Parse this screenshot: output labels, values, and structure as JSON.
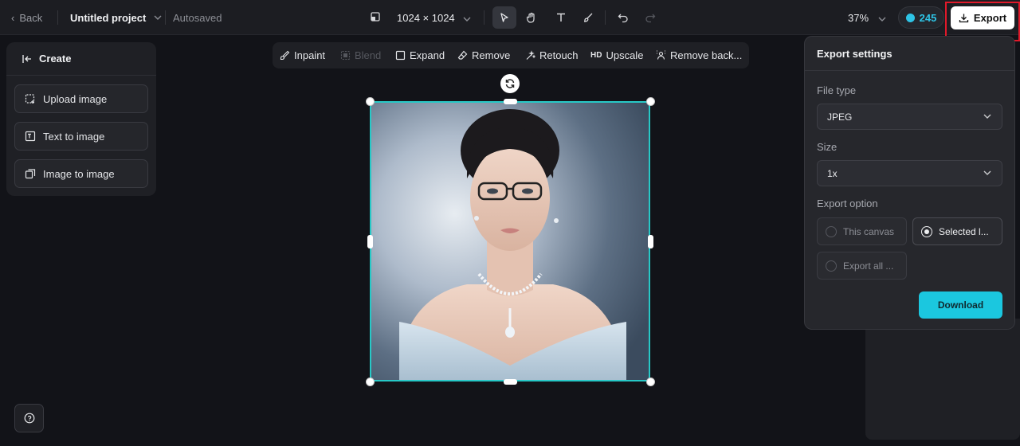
{
  "topbar": {
    "back_label": "Back",
    "project_title": "Untitled project",
    "autosaved": "Autosaved",
    "canvas_size": "1024 × 1024",
    "zoom": "37%",
    "credits": "245",
    "export_label": "Export"
  },
  "create_panel": {
    "title": "Create",
    "items": [
      {
        "label": "Upload image",
        "icon": "upload-image-icon"
      },
      {
        "label": "Text to image",
        "icon": "text-to-image-icon"
      },
      {
        "label": "Image to image",
        "icon": "image-to-image-icon"
      }
    ]
  },
  "edit_toolbar": {
    "items": [
      {
        "label": "Inpaint",
        "icon": "inpaint-icon",
        "enabled": true
      },
      {
        "label": "Blend",
        "icon": "blend-icon",
        "enabled": false
      },
      {
        "label": "Expand",
        "icon": "expand-icon",
        "enabled": true
      },
      {
        "label": "Remove",
        "icon": "eraser-icon",
        "enabled": true
      },
      {
        "label": "Retouch",
        "icon": "retouch-icon",
        "enabled": true
      },
      {
        "label": "Upscale",
        "icon": "hd-icon",
        "enabled": true,
        "badge": "HD"
      },
      {
        "label": "Remove back...",
        "icon": "remove-background-icon",
        "enabled": true
      }
    ]
  },
  "export_settings": {
    "title": "Export settings",
    "file_type_label": "File type",
    "file_type_value": "JPEG",
    "size_label": "Size",
    "size_value": "1x",
    "export_option_label": "Export option",
    "options": [
      {
        "label": "This canvas",
        "selected": false
      },
      {
        "label": "Selected l...",
        "selected": true
      },
      {
        "label": "Export all ...",
        "selected": false
      }
    ],
    "download_label": "Download"
  },
  "colors": {
    "accent": "#1bc7df",
    "selection": "#27c8c6",
    "highlight": "#e0192a"
  }
}
